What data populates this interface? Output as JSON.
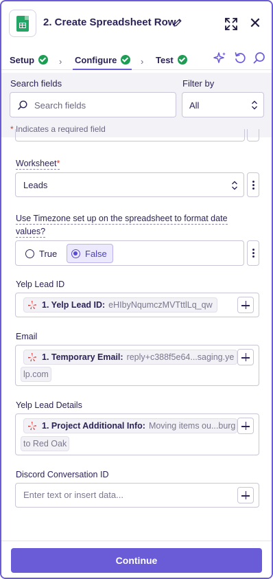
{
  "header": {
    "title": "2. Create Spreadsheet Row",
    "app_icon": "google-sheets-icon",
    "edit_icon": "pencil-icon",
    "expand_icon": "expand-icon",
    "close_label": "✕"
  },
  "tabs": [
    {
      "label": "Setup",
      "status": "complete"
    },
    {
      "label": "Configure",
      "status": "complete",
      "active": true
    },
    {
      "label": "Test",
      "status": "complete"
    }
  ],
  "tab_separator": "›",
  "toolbar_icons": [
    "sparkle-icon",
    "undo-icon",
    "search-icon"
  ],
  "search": {
    "label": "Search fields",
    "placeholder": "Search fields"
  },
  "filter": {
    "label": "Filter by",
    "value": "All"
  },
  "required_note": {
    "star": "*",
    "text": " Indicates a required field"
  },
  "fields": {
    "worksheet": {
      "label": "Worksheet",
      "required_mark": "*",
      "value": "Leads"
    },
    "timezone": {
      "label_line1": "Use Timezone set up on the spreadsheet to format date",
      "label_line2": "values?",
      "options": [
        {
          "label": "True",
          "selected": false
        },
        {
          "label": "False",
          "selected": true
        }
      ]
    },
    "yelp_lead_id": {
      "label": "Yelp Lead ID",
      "step": "1. Yelp Lead ID:",
      "value": "eHIbyNqumczMVTttlLq_qw"
    },
    "email": {
      "label": "Email",
      "step": "1. Temporary Email:",
      "value": "reply+c388f5e64...saging.ye",
      "value_cont": "lp.com"
    },
    "yelp_lead_details": {
      "label": "Yelp Lead Details",
      "step": "1. Project Additional Info:",
      "value": "Moving items ou...burg",
      "value_cont": "to Red Oak"
    },
    "discord_conversation_id": {
      "label": "Discord Conversation ID",
      "placeholder": "Enter text or insert data..."
    }
  },
  "footer": {
    "continue_label": "Continue"
  },
  "colors": {
    "accent": "#6a5bd6",
    "success": "#1f9d55",
    "required": "#d63a2e",
    "yelp": "#d32323"
  }
}
